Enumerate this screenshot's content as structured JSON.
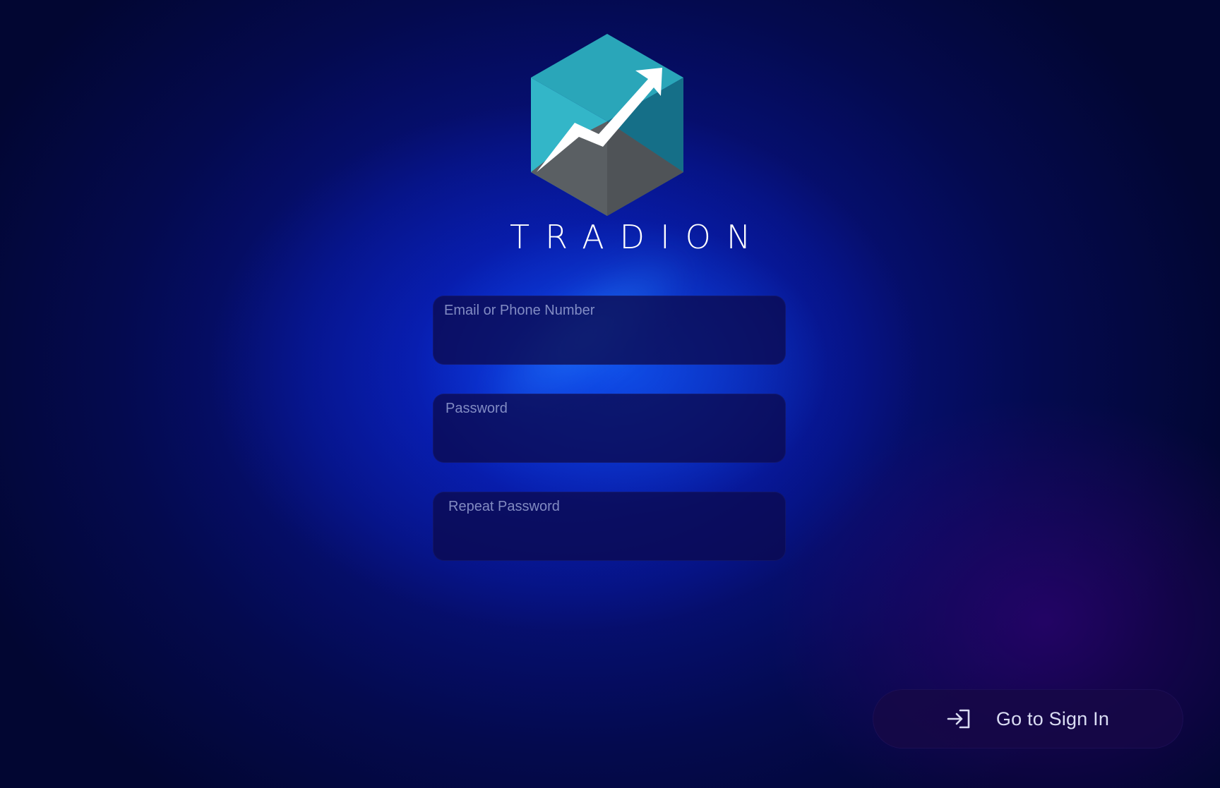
{
  "brand": {
    "name": "TRADION",
    "logo_icon": "hexagon-cube-trend-arrow-icon",
    "colors": {
      "teal_light": "#36b8c9",
      "teal_dark": "#1a7c95",
      "gray": "#5c6166",
      "arrow": "#ffffff"
    }
  },
  "form": {
    "email": {
      "label": "Email or Phone Number",
      "value": ""
    },
    "password": {
      "label": "Password",
      "value": ""
    },
    "repeat_password": {
      "label": "Repeat Password",
      "value": ""
    }
  },
  "actions": {
    "go_to_sign_in": {
      "label": "Go to Sign In",
      "icon": "sign-in-icon"
    }
  }
}
